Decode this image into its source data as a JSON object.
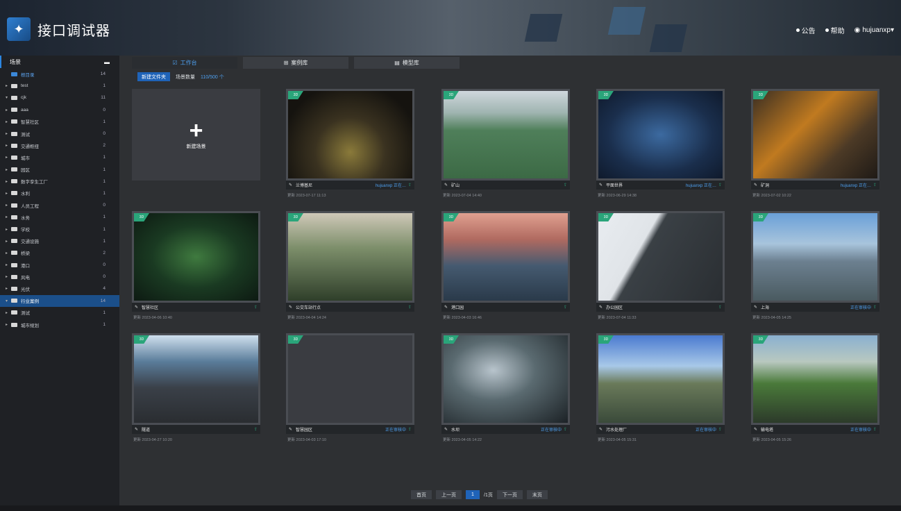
{
  "header": {
    "app_title": "接口调试器",
    "links": [
      "公告",
      "帮助"
    ],
    "user": "hujuanxp▾"
  },
  "sidebar": {
    "title": "场景",
    "items": [
      {
        "label": "根目录",
        "count": "14"
      },
      {
        "label": "test",
        "count": "1"
      },
      {
        "label": "cjk",
        "count": "11"
      },
      {
        "label": "aaa",
        "count": "0"
      },
      {
        "label": "智慧社区",
        "count": "1"
      },
      {
        "label": "测试",
        "count": "0"
      },
      {
        "label": "交通枢纽",
        "count": "2"
      },
      {
        "label": "城市",
        "count": "1"
      },
      {
        "label": "园区",
        "count": "1"
      },
      {
        "label": "数字孪生工厂",
        "count": "1"
      },
      {
        "label": "水利",
        "count": "1"
      },
      {
        "label": "人员工程",
        "count": "0"
      },
      {
        "label": "水务",
        "count": "1"
      },
      {
        "label": "学校",
        "count": "1"
      },
      {
        "label": "交通设施",
        "count": "1"
      },
      {
        "label": "桥梁",
        "count": "2"
      },
      {
        "label": "港口",
        "count": "0"
      },
      {
        "label": "风电",
        "count": "0"
      },
      {
        "label": "光伏",
        "count": "4"
      },
      {
        "label": "行业案例",
        "count": "14"
      },
      {
        "label": "测试",
        "count": "1"
      },
      {
        "label": "城市规划",
        "count": "1"
      }
    ]
  },
  "tabs": [
    "工作台",
    "案例库",
    "模型库"
  ],
  "toolbar": {
    "new_folder": "新建文件夹",
    "sync_label": "场景数量",
    "sync_count": "110/500 个"
  },
  "new_card_label": "新建场景",
  "cards": [
    {
      "name": "兰博基尼",
      "status": "hujuanxp 正在…",
      "date": "更新 2023-07-17 11:13",
      "badge": "3D"
    },
    {
      "name": "矿山",
      "status": "",
      "date": "更新 2023-07-04 14:40",
      "badge": "3D"
    },
    {
      "name": "平面世界",
      "status": "hujuanxp 正在…",
      "date": "更新 2023-06-29 14:38",
      "badge": "3D"
    },
    {
      "name": "矿洞",
      "status": "hujuanxp 正在…",
      "date": "更新 2023-07-02 10:22",
      "badge": "3D"
    },
    {
      "name": "智慧社区",
      "status": "",
      "date": "更新 2023-04-06 10:40",
      "badge": "3D"
    },
    {
      "name": "公交车站行点",
      "status": "",
      "date": "更新 2023-04-04 14:24",
      "badge": "3D"
    },
    {
      "name": "港口园",
      "status": "",
      "date": "更新 2023-04-03 16:46",
      "badge": "3D"
    },
    {
      "name": "办公园区",
      "status": "",
      "date": "更新 2023-07-04 11:33",
      "badge": "3D"
    },
    {
      "name": "上海",
      "status": "正在审核中",
      "date": "更新 2023-04-05 14:25",
      "badge": "3D"
    },
    {
      "name": "隧道",
      "status": "",
      "date": "更新 2023-04-27 10:20",
      "badge": "3D"
    },
    {
      "name": "智慧园区",
      "status": "正在审核中",
      "date": "更新 2023-04-03 17:10",
      "badge": "3D"
    },
    {
      "name": "水坝",
      "status": "正在审核中",
      "date": "更新 2023-04-05 14:22",
      "badge": "3D"
    },
    {
      "name": "污水处理厂",
      "status": "正在审核中",
      "date": "更新 2023-04-05 15:31",
      "badge": "3D"
    },
    {
      "name": "输电塔",
      "status": "正在审核中",
      "date": "更新 2023-04-05 15:26",
      "badge": "3D"
    }
  ],
  "pager": {
    "first": "首页",
    "prev": "上一页",
    "page": "1",
    "total": "/1页",
    "next": "下一页",
    "last": "末页"
  }
}
